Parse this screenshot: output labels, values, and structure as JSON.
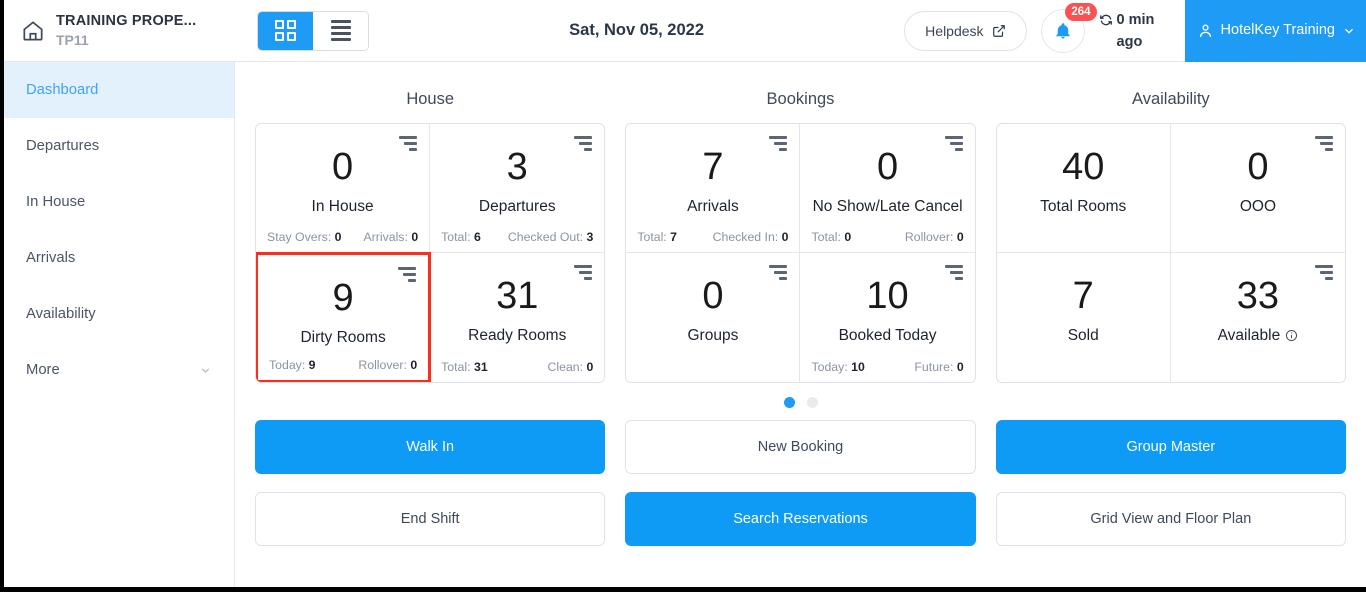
{
  "header": {
    "property_name": "TRAINING PROPE...",
    "property_code": "TP11",
    "date": "Sat, Nov 05, 2022",
    "helpdesk_label": "Helpdesk",
    "notification_count": "264",
    "sync_text": "0 min ago",
    "user_name": "HotelKey Training"
  },
  "sidebar": {
    "items": [
      {
        "label": "Dashboard"
      },
      {
        "label": "Departures"
      },
      {
        "label": "In House"
      },
      {
        "label": "Arrivals"
      },
      {
        "label": "Availability"
      },
      {
        "label": "More"
      }
    ]
  },
  "sections": [
    {
      "title": "House",
      "cards": [
        {
          "value": "0",
          "label": "In House",
          "stat_left_label": "Stay Overs:",
          "stat_left_value": "0",
          "stat_right_label": "Arrivals:",
          "stat_right_value": "0",
          "filter": true,
          "highlight": false,
          "info": false
        },
        {
          "value": "3",
          "label": "Departures",
          "stat_left_label": "Total:",
          "stat_left_value": "6",
          "stat_right_label": "Checked Out:",
          "stat_right_value": "3",
          "filter": true,
          "highlight": false,
          "info": false
        },
        {
          "value": "9",
          "label": "Dirty Rooms",
          "stat_left_label": "Today:",
          "stat_left_value": "9",
          "stat_right_label": "Rollover:",
          "stat_right_value": "0",
          "filter": true,
          "highlight": true,
          "info": false
        },
        {
          "value": "31",
          "label": "Ready Rooms",
          "stat_left_label": "Total:",
          "stat_left_value": "31",
          "stat_right_label": "Clean:",
          "stat_right_value": "0",
          "filter": true,
          "highlight": false,
          "info": false
        }
      ]
    },
    {
      "title": "Bookings",
      "cards": [
        {
          "value": "7",
          "label": "Arrivals",
          "stat_left_label": "Total:",
          "stat_left_value": "7",
          "stat_right_label": "Checked In:",
          "stat_right_value": "0",
          "filter": true,
          "highlight": false,
          "info": false
        },
        {
          "value": "0",
          "label": "No Show/Late Cancel",
          "stat_left_label": "Total:",
          "stat_left_value": "0",
          "stat_right_label": "Rollover:",
          "stat_right_value": "0",
          "filter": true,
          "highlight": false,
          "info": false
        },
        {
          "value": "0",
          "label": "Groups",
          "stat_left_label": "",
          "stat_left_value": "",
          "stat_right_label": "",
          "stat_right_value": "",
          "filter": true,
          "highlight": false,
          "info": false
        },
        {
          "value": "10",
          "label": "Booked Today",
          "stat_left_label": "Today:",
          "stat_left_value": "10",
          "stat_right_label": "Future:",
          "stat_right_value": "0",
          "filter": true,
          "highlight": false,
          "info": false
        }
      ]
    },
    {
      "title": "Availability",
      "cards": [
        {
          "value": "40",
          "label": "Total Rooms",
          "stat_left_label": "",
          "stat_left_value": "",
          "stat_right_label": "",
          "stat_right_value": "",
          "filter": false,
          "highlight": false,
          "info": false
        },
        {
          "value": "0",
          "label": "OOO",
          "stat_left_label": "",
          "stat_left_value": "",
          "stat_right_label": "",
          "stat_right_value": "",
          "filter": true,
          "highlight": false,
          "info": false
        },
        {
          "value": "7",
          "label": "Sold",
          "stat_left_label": "",
          "stat_left_value": "",
          "stat_right_label": "",
          "stat_right_value": "",
          "filter": false,
          "highlight": false,
          "info": false
        },
        {
          "value": "33",
          "label": "Available",
          "stat_left_label": "",
          "stat_left_value": "",
          "stat_right_label": "",
          "stat_right_value": "",
          "filter": true,
          "highlight": false,
          "info": true
        }
      ]
    }
  ],
  "carousel": {
    "pages": 2,
    "active": 0
  },
  "actions": [
    {
      "label": "Walk In",
      "primary": true
    },
    {
      "label": "New Booking",
      "primary": false
    },
    {
      "label": "Group Master",
      "primary": true
    },
    {
      "label": "End Shift",
      "primary": false
    },
    {
      "label": "Search Reservations",
      "primary": true
    },
    {
      "label": "Grid View and Floor Plan",
      "primary": false
    }
  ],
  "colors": {
    "accent": "#1e9bf5",
    "highlight_border": "#fb2d1c",
    "badge": "#fa5252",
    "active_nav_bg": "#e3f1fd"
  }
}
